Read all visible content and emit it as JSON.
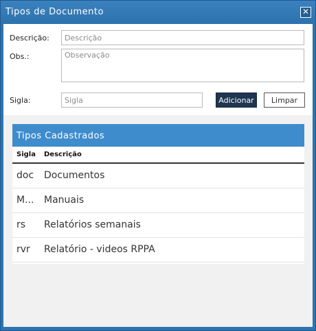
{
  "window": {
    "title": "Tipos de Documento",
    "close_glyph": "✕"
  },
  "form": {
    "descricao_label": "Descrição:",
    "descricao_placeholder": "Descrição",
    "obs_label": "Obs.:",
    "obs_placeholder": "Observação",
    "sigla_label": "Sigla:",
    "sigla_placeholder": "Sigla",
    "add_button": "Adicionar",
    "clear_button": "Limpar"
  },
  "list": {
    "title": "Tipos Cadastrados",
    "columns": [
      "Sigla",
      "Descrição"
    ],
    "rows": [
      {
        "sigla": "doc",
        "descricao": "Documentos"
      },
      {
        "sigla": "M...",
        "descricao": "Manuais"
      },
      {
        "sigla": "rs",
        "descricao": "Relatórios semanais"
      },
      {
        "sigla": "rvr",
        "descricao": "Relatório - videos RPPA"
      }
    ]
  },
  "colors": {
    "titlebar": "#2e74b0",
    "list_header": "#3f8ccd",
    "primary_button": "#1f3550"
  }
}
